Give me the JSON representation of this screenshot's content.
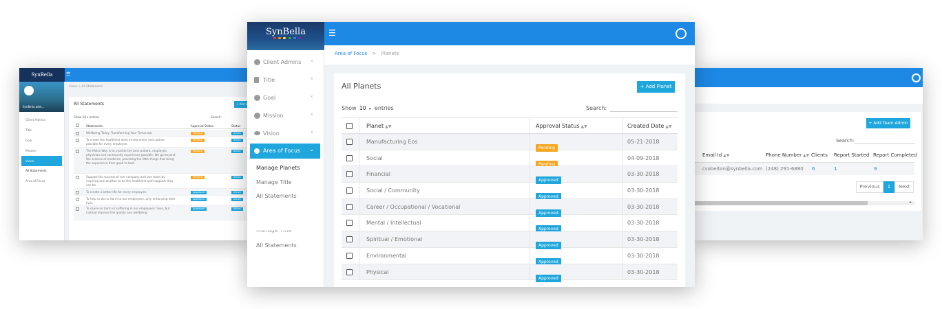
{
  "back_left": {
    "logo": "SynBella",
    "menu_icon": "hamburger-icon",
    "profile_name": "SynBella adm...",
    "sidebar": [
      {
        "label": "Client Admins",
        "icon": "user-circle-icon"
      },
      {
        "label": "Title",
        "icon": "document-icon"
      },
      {
        "label": "Goal",
        "icon": "question-icon"
      },
      {
        "label": "Mission",
        "icon": "rocket-icon"
      },
      {
        "label": "Vision",
        "icon": "eye-icon"
      },
      {
        "label": "Area of Focus",
        "icon": "focus-icon"
      }
    ],
    "active_sub": "All Statements",
    "breadcrumb": "Vision  >  All Statements",
    "title": "All Statements",
    "add_button": "+ Add St",
    "show_label": "Show 10  ▾  entries",
    "search_label": "Search:",
    "columns": [
      "Statements",
      "Approval Status",
      "Status"
    ],
    "rows": [
      {
        "text": "Wellbeing Today. Transforming Your Tomorrow.",
        "approval": "Pending",
        "status": "Active"
      },
      {
        "text": "To create the healthiest work environment and culture possible for every employee.",
        "approval": "Pending",
        "status": "Active"
      },
      {
        "text": "The Metro Way is to provide the best patient, employee, physician and community experience possible. We go beyond the science of medicine, providing the little things that bring the experience from good to best.",
        "approval": "Pending",
        "status": "Active"
      },
      {
        "text": "Support the success of one company and one team by inspiring one another to be the healthiest and happiest they can be.",
        "approval": "Pending",
        "status": "Active"
      },
      {
        "text": "To create a better life for every employee.",
        "approval": "Approved",
        "status": "Active"
      },
      {
        "text": "To help or do no harm to our employees, only enhancing their lives.",
        "approval": "Approved",
        "status": "Active"
      },
      {
        "text": "To cause no harm or suffering in our employees' lives, but instead improve the quality and wellbeing",
        "approval": "Approved",
        "status": "Active"
      }
    ]
  },
  "back_right": {
    "add_button": "+ Add Team Admin",
    "search_label": "Search:",
    "columns": [
      "Email Id",
      "Phone Number",
      "Clients",
      "Report Started",
      "Report Completed"
    ],
    "row": {
      "email": "csobelton@synbella.com",
      "phone": "(248) 291-6880",
      "clients": "6",
      "report_started": "1",
      "report_completed": "9"
    },
    "pager": {
      "previous": "Previous",
      "current": "1",
      "next": "Next"
    }
  },
  "main": {
    "logo": "SynBella",
    "menu_icon": "hamburger-icon",
    "user_icon": "user-circle-icon",
    "sidebar": [
      {
        "label": "Client Admins",
        "icon": "user-circle-icon"
      },
      {
        "label": "Title",
        "icon": "document-icon"
      },
      {
        "label": "Goal",
        "icon": "question-icon"
      },
      {
        "label": "Mission",
        "icon": "rocket-icon"
      },
      {
        "label": "Vision",
        "icon": "eye-icon"
      },
      {
        "label": "Area of Focus",
        "icon": "focus-icon"
      }
    ],
    "subitems": [
      "Manage Planets",
      "Manage Title",
      "All Statements"
    ],
    "subitems_lower": [
      "Manage Title",
      "All Statements"
    ],
    "breadcrumb": {
      "link": "Area of Focus",
      "sep": ">",
      "current": "Planets"
    },
    "title": "All Planets",
    "add_button": "+ Add Planet",
    "show": {
      "prefix": "Show",
      "value": "10",
      "suffix": "entries"
    },
    "search_label": "Search:",
    "columns": {
      "planet": "Planet",
      "approval": "Approval Status",
      "created": "Created Date"
    },
    "rows": [
      {
        "planet": "Manufacturing Eos",
        "approval": "Pending",
        "date": "05-21-2018"
      },
      {
        "planet": "Social",
        "approval": "Pending",
        "date": "04-09-2018"
      },
      {
        "planet": "Financial",
        "approval": "Approved",
        "date": "03-30-2018"
      },
      {
        "planet": "Social / Community",
        "approval": "Approved",
        "date": "03-30-2018"
      },
      {
        "planet": "Career / Occupational / Vocational",
        "approval": "Approved",
        "date": "03-30-2018"
      },
      {
        "planet": "Mental / Intellectual",
        "approval": "Approved",
        "date": "03-30-2018"
      },
      {
        "planet": "Spiritual / Emotional",
        "approval": "Approved",
        "date": "03-30-2018"
      },
      {
        "planet": "Environmental",
        "approval": "Approved",
        "date": "03-30-2018"
      },
      {
        "planet": "Physical",
        "approval": "Approved",
        "date": "03-30-2018"
      }
    ]
  },
  "colors": {
    "header": "#1e88e5",
    "accent": "#1ea6dd",
    "pending": "#f5a623",
    "approved": "#1ea6dd"
  }
}
